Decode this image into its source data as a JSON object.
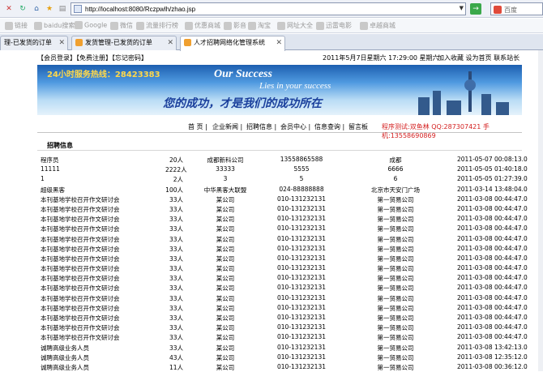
{
  "browser": {
    "url": "http://localhost:8080/Rczpwlh/zhao.jsp",
    "search_placeholder": "百度",
    "favorites": [
      "链接",
      "baidu搜索",
      "Google",
      "微信",
      "流量排行榜",
      "优惠商城",
      "影音",
      "淘宝",
      "网址大全",
      "迅雷电影",
      "卓越商城"
    ],
    "tabs": [
      {
        "label": "理-已发货的订单"
      },
      {
        "label": "发货管理-已发货的订单"
      },
      {
        "label": "人才招聘网络化管理系统"
      }
    ]
  },
  "header": {
    "login": "【会员登录】",
    "register": "【免费注册】",
    "forgot": "【忘记密码】",
    "date": "2011年5月7日星期六 17:29:00 星期六",
    "add_fav": "加入收藏",
    "set_home": "设为首页",
    "contact": "联系站长"
  },
  "banner": {
    "hotline": "24小时服务热线：28423383",
    "slogan1": "Our Success",
    "slogan2": "Lies in your success",
    "slogan3": "您的成功，才是我们的成功所在"
  },
  "menu": {
    "items": [
      "首 页",
      "企业新闻",
      "招聘信息",
      "会员中心",
      "信息查询",
      "留言板"
    ],
    "promo": "程序测试:双鱼林 QQ:287307421 手机:13558690869"
  },
  "section_title": "招聘信息",
  "rows": [
    [
      "程序员",
      "20人",
      "成都新科公司",
      "13558865588",
      "成都",
      "2011-05-07 00:08:13.0"
    ],
    [
      "11111",
      "2222人",
      "33333",
      "5555",
      "6666",
      "2011-05-05 01:40:18.0"
    ],
    [
      "1",
      "2人",
      "3",
      "5",
      "6",
      "2011-05-05 01:27:39.0"
    ],
    [
      "超级黑客",
      "100人",
      "中华黑客大联盟",
      "024-88888888",
      "北京市天安门广场",
      "2011-03-14 13:48:04.0"
    ],
    [
      "本刊基地学校召开作文研讨会",
      "33人",
      "某公司",
      "010-131232131",
      "第一贸易公司",
      "2011-03-08 00:44:47.0"
    ],
    [
      "本刊基地学校召开作文研讨会",
      "33人",
      "某公司",
      "010-131232131",
      "第一贸易公司",
      "2011-03-08 00:44:47.0"
    ],
    [
      "本刊基地学校召开作文研讨会",
      "33人",
      "某公司",
      "010-131232131",
      "第一贸易公司",
      "2011-03-08 00:44:47.0"
    ],
    [
      "本刊基地学校召开作文研讨会",
      "33人",
      "某公司",
      "010-131232131",
      "第一贸易公司",
      "2011-03-08 00:44:47.0"
    ],
    [
      "本刊基地学校召开作文研讨会",
      "33人",
      "某公司",
      "010-131232131",
      "第一贸易公司",
      "2011-03-08 00:44:47.0"
    ],
    [
      "本刊基地学校召开作文研讨会",
      "33人",
      "某公司",
      "010-131232131",
      "第一贸易公司",
      "2011-03-08 00:44:47.0"
    ],
    [
      "本刊基地学校召开作文研讨会",
      "33人",
      "某公司",
      "010-131232131",
      "第一贸易公司",
      "2011-03-08 00:44:47.0"
    ],
    [
      "本刊基地学校召开作文研讨会",
      "33人",
      "某公司",
      "010-131232131",
      "第一贸易公司",
      "2011-03-08 00:44:47.0"
    ],
    [
      "本刊基地学校召开作文研讨会",
      "33人",
      "某公司",
      "010-131232131",
      "第一贸易公司",
      "2011-03-08 00:44:47.0"
    ],
    [
      "本刊基地学校召开作文研讨会",
      "33人",
      "某公司",
      "010-131232131",
      "第一贸易公司",
      "2011-03-08 00:44:47.0"
    ],
    [
      "本刊基地学校召开作文研讨会",
      "33人",
      "某公司",
      "010-131232131",
      "第一贸易公司",
      "2011-03-08 00:44:47.0"
    ],
    [
      "本刊基地学校召开作文研讨会",
      "33人",
      "某公司",
      "010-131232131",
      "第一贸易公司",
      "2011-03-08 00:44:47.0"
    ],
    [
      "本刊基地学校召开作文研讨会",
      "33人",
      "某公司",
      "010-131232131",
      "第一贸易公司",
      "2011-03-08 00:44:47.0"
    ],
    [
      "本刊基地学校召开作文研讨会",
      "33人",
      "某公司",
      "010-131232131",
      "第一贸易公司",
      "2011-03-08 00:44:47.0"
    ],
    [
      "本刊基地学校召开作文研讨会",
      "33人",
      "某公司",
      "010-131232131",
      "第一贸易公司",
      "2011-03-08 00:44:47.0"
    ],
    [
      "诚聘高级业务人员",
      "33人",
      "某公司",
      "010-131232131",
      "第一贸易公司",
      "2011-03-08 13:42:13.0"
    ],
    [
      "诚聘高级业务人员",
      "43人",
      "某公司",
      "010-131232131",
      "第一贸易公司",
      "2011-03-08 12:35:12.0"
    ],
    [
      "诚聘高级业务人员",
      "11人",
      "某公司",
      "010-131232131",
      "第一贸易公司",
      "2011-03-08 00:36:12.0"
    ]
  ]
}
